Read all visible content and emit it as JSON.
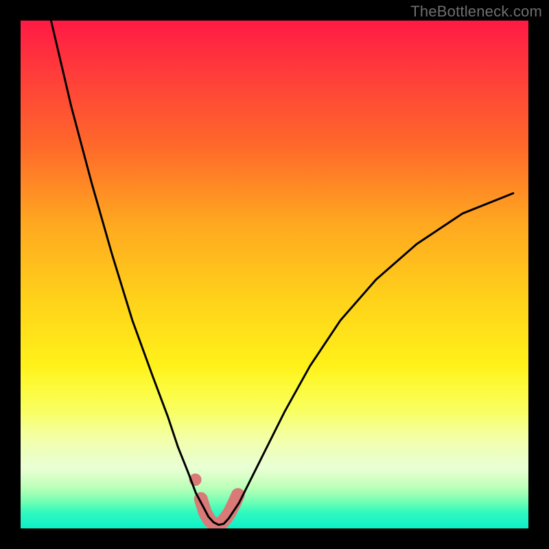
{
  "watermark": "TheBottleneck.com",
  "chart_data": {
    "type": "line",
    "title": "",
    "xlabel": "",
    "ylabel": "",
    "xlim": [
      0,
      100
    ],
    "ylim": [
      0,
      100
    ],
    "grid": false,
    "legend": "none",
    "series": [
      {
        "name": "bottleneck-curve",
        "color": "#000000",
        "x": [
          6,
          10,
          14,
          18,
          22,
          26,
          29,
          31,
          33,
          34.5,
          36,
          37,
          38,
          39,
          40,
          41,
          43,
          45,
          48,
          52,
          57,
          63,
          70,
          78,
          87,
          97
        ],
        "values": [
          100,
          83,
          68,
          54,
          41,
          30,
          22,
          16,
          11,
          7,
          4.2,
          2.3,
          1.2,
          0.7,
          0.9,
          2.0,
          5,
          9,
          15,
          23,
          32,
          41,
          49,
          56,
          62,
          66
        ]
      },
      {
        "name": "recommended-zone",
        "color": "#d97a78",
        "x": [
          35.5,
          36.3,
          37.2,
          38,
          38.8,
          39.6,
          40.4,
          41.2,
          42,
          42.8
        ],
        "values": [
          5.8,
          3.2,
          1.6,
          0.9,
          0.8,
          1.1,
          2.0,
          3.2,
          4.8,
          6.6
        ]
      }
    ],
    "markers": [
      {
        "name": "recommended-dot",
        "x": 34.4,
        "y": 9.6,
        "color": "#d97a78"
      }
    ]
  }
}
